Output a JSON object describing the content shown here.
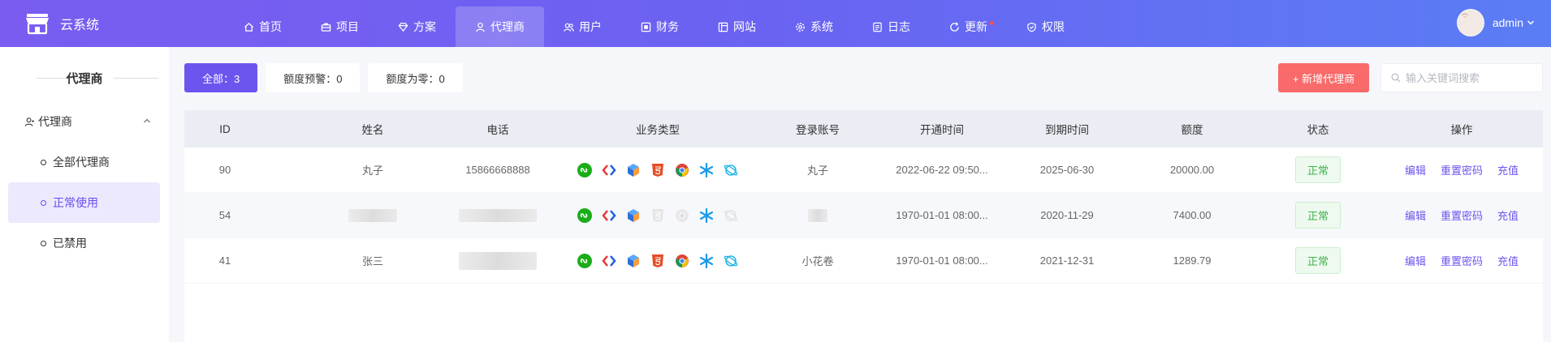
{
  "brand": {
    "name": "云系统"
  },
  "nav": [
    {
      "label": "首页",
      "icon": "home-icon"
    },
    {
      "label": "项目",
      "icon": "briefcase-icon"
    },
    {
      "label": "方案",
      "icon": "diamond-icon"
    },
    {
      "label": "代理商",
      "icon": "user-icon",
      "active": true
    },
    {
      "label": "用户",
      "icon": "users-icon"
    },
    {
      "label": "财务",
      "icon": "finance-icon"
    },
    {
      "label": "网站",
      "icon": "website-icon"
    },
    {
      "label": "系统",
      "icon": "gear-icon"
    },
    {
      "label": "日志",
      "icon": "log-icon"
    },
    {
      "label": "更新",
      "icon": "refresh-icon",
      "dot": true
    },
    {
      "label": "权限",
      "icon": "shield-icon"
    }
  ],
  "user": {
    "name": "admin"
  },
  "sidebar": {
    "title": "代理商",
    "group": "代理商",
    "items": [
      {
        "label": "全部代理商"
      },
      {
        "label": "正常使用",
        "active": true
      },
      {
        "label": "已禁用"
      }
    ]
  },
  "filters": [
    {
      "label": "全部：3",
      "active": true
    },
    {
      "label": "额度预警：0"
    },
    {
      "label": "额度为零：0"
    }
  ],
  "toolbar": {
    "add_label": "+ 新增代理商"
  },
  "search": {
    "placeholder": "输入关键词搜索",
    "value": ""
  },
  "table": {
    "headers": [
      "ID",
      "姓名",
      "电话",
      "业务类型",
      "登录账号",
      "开通时间",
      "到期时间",
      "额度",
      "状态",
      "操作"
    ],
    "rows": [
      {
        "id": "90",
        "name": "丸子",
        "phone": "15866668888",
        "account": "丸子",
        "open": "2022-06-22 09:50...",
        "expire": "2025-06-30",
        "quota": "20000.00",
        "status": "正常",
        "biz_html5": true,
        "biz_chrome": true,
        "biz_planet": true
      },
      {
        "id": "54",
        "name": "",
        "phone": "",
        "account": "",
        "open": "1970-01-01 08:00...",
        "expire": "2020-11-29",
        "quota": "7400.00",
        "status": "正常",
        "biz_html5": false,
        "biz_chrome": false,
        "biz_planet": false
      },
      {
        "id": "41",
        "name": "张三",
        "phone": "",
        "account": "小花卷",
        "open": "1970-01-01 08:00...",
        "expire": "2021-12-31",
        "quota": "1289.79",
        "status": "正常",
        "biz_html5": true,
        "biz_chrome": true,
        "biz_planet": true
      }
    ],
    "actions": [
      "编辑",
      "重置密码",
      "充值"
    ]
  },
  "colors": {
    "accent": "#6c55ee",
    "add_button": "#f96a6a",
    "status_ok": "#3db34a"
  }
}
